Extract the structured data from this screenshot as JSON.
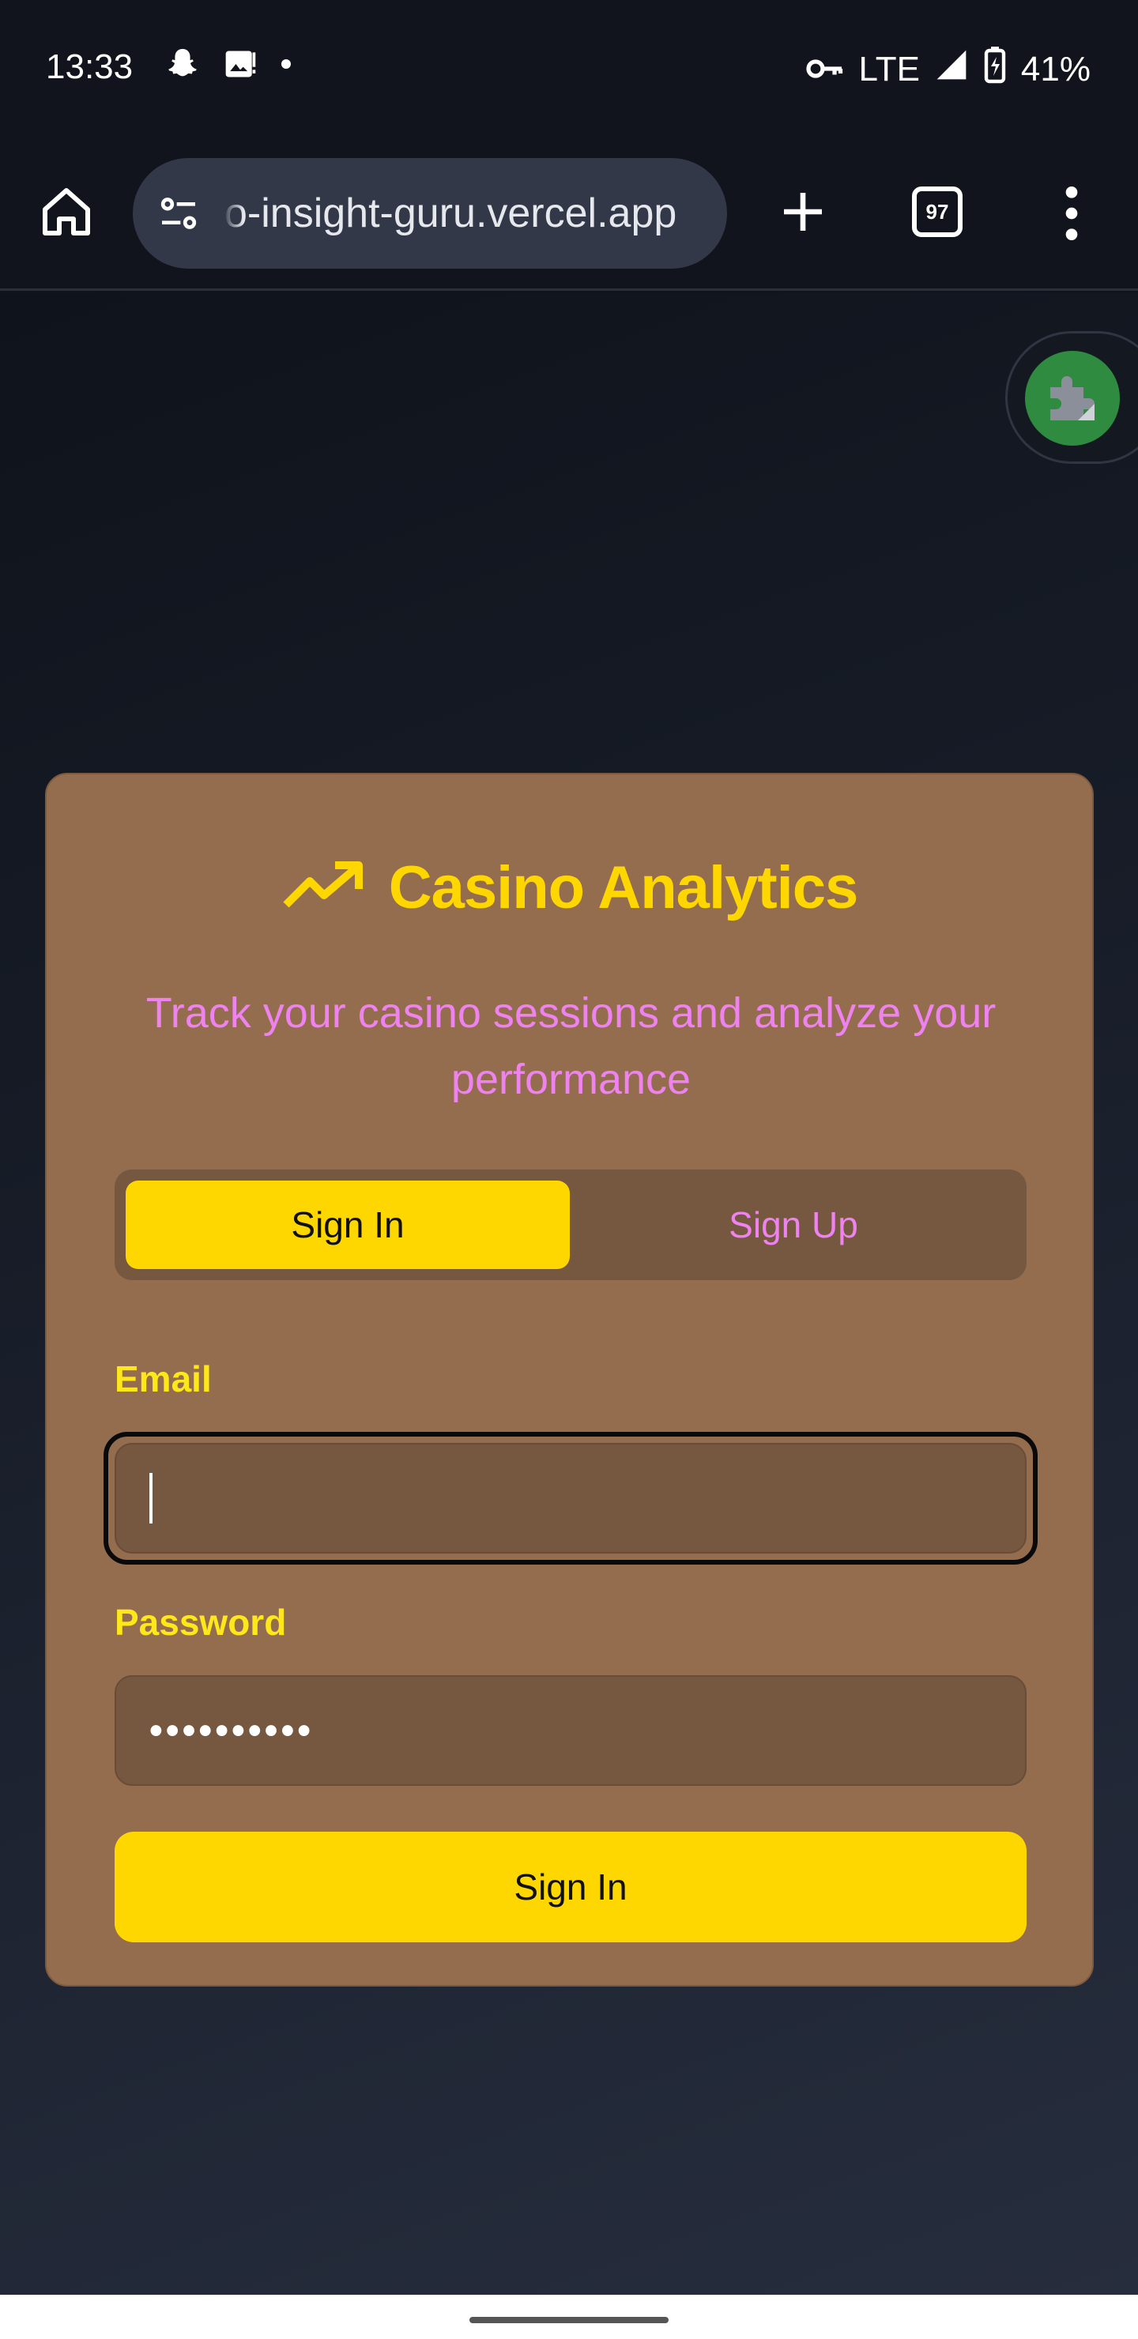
{
  "status_bar": {
    "time": "13:33",
    "network": "LTE",
    "battery": "41%",
    "icons": [
      "snapchat-icon",
      "image-alert-icon",
      "dot-icon",
      "vpn-key-icon",
      "signal-icon",
      "battery-charging-icon"
    ]
  },
  "browser": {
    "url": "o-insight-guru.vercel.app",
    "tab_count": "97",
    "icons": [
      "home-icon",
      "tune-icon",
      "plus-icon",
      "menu-dots-icon"
    ]
  },
  "extension": {
    "icon": "puzzle-icon"
  },
  "card": {
    "title": "Casino Analytics",
    "title_icon": "trending-up-icon",
    "subtitle": "Track your casino sessions and analyze your performance",
    "tabs": [
      {
        "label": "Sign In",
        "active": true
      },
      {
        "label": "Sign Up",
        "active": false
      }
    ],
    "email_label": "Email",
    "email_value": "",
    "password_label": "Password",
    "password_value": "••••••••••",
    "submit_label": "Sign In"
  },
  "colors": {
    "accent": "#ffd700",
    "subtitle": "#ee82ee",
    "card": "#946c4e",
    "input": "#765840",
    "background": "#11141c"
  }
}
